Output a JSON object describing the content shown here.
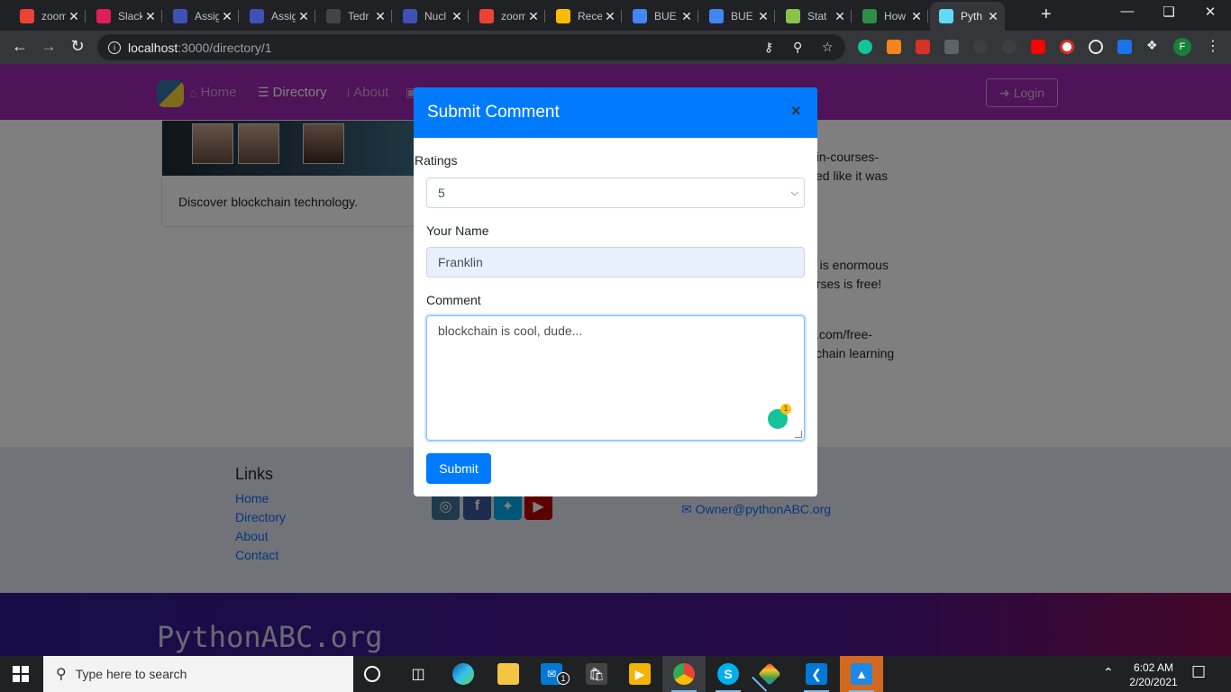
{
  "browser": {
    "tabs": [
      {
        "title": "zoom",
        "favicon": "gmail-icon",
        "color": "#ea4335"
      },
      {
        "title": "Slack",
        "favicon": "slack-icon",
        "color": "#e01e5a"
      },
      {
        "title": "Assignment",
        "favicon": "course-icon",
        "color": "#3f51b5"
      },
      {
        "title": "Assignment",
        "favicon": "course-icon",
        "color": "#3f51b5"
      },
      {
        "title": "Tedr",
        "favicon": "github-icon",
        "color": "#444444"
      },
      {
        "title": "Nucl",
        "favicon": "course-icon",
        "color": "#3f51b5"
      },
      {
        "title": "zoom",
        "favicon": "gmail-icon",
        "color": "#ea4335"
      },
      {
        "title": "Rece",
        "favicon": "drive-icon",
        "color": "#fbbc04"
      },
      {
        "title": "BUE",
        "favicon": "docs-icon",
        "color": "#4285f4"
      },
      {
        "title": "BUE",
        "favicon": "docs-icon",
        "color": "#4285f4"
      },
      {
        "title": "Stat",
        "favicon": "node-icon",
        "color": "#8bc34a"
      },
      {
        "title": "How",
        "favicon": "geeks-icon",
        "color": "#2f8d46"
      },
      {
        "title": "Pyth",
        "favicon": "react-icon",
        "color": "#61dafb"
      }
    ],
    "url_host": "localhost",
    "url_path": ":3000/directory/1",
    "profile_initial": "F"
  },
  "site": {
    "nav": {
      "home": "Home",
      "directory": "Directory",
      "about": "About",
      "login": "Login"
    },
    "card_text": "Discover blockchain technology.",
    "right_lines": [
      "ain-courses-",
      "ked like it was",
      "n is enormous",
      "urses is free!",
      "s.com/free-",
      "kchain learning"
    ],
    "footer": {
      "links_heading": "Links",
      "links": [
        "Home",
        "Directory",
        "About",
        "Contact"
      ],
      "email": "Owner@pythonABC.org",
      "brand": "PythonABC.org"
    }
  },
  "modal": {
    "title": "Submit Comment",
    "close": "×",
    "ratings_label": "Ratings",
    "ratings_value": "5",
    "name_label": "Your Name",
    "name_value": "Franklin",
    "comment_label": "Comment",
    "comment_value": "blockchain is cool, dude...",
    "grammarly_count": "1",
    "submit_label": "Submit"
  },
  "taskbar": {
    "search_placeholder": "Type here to search",
    "mail_badge": "1",
    "time": "6:02 AM",
    "date": "2/20/2021"
  }
}
